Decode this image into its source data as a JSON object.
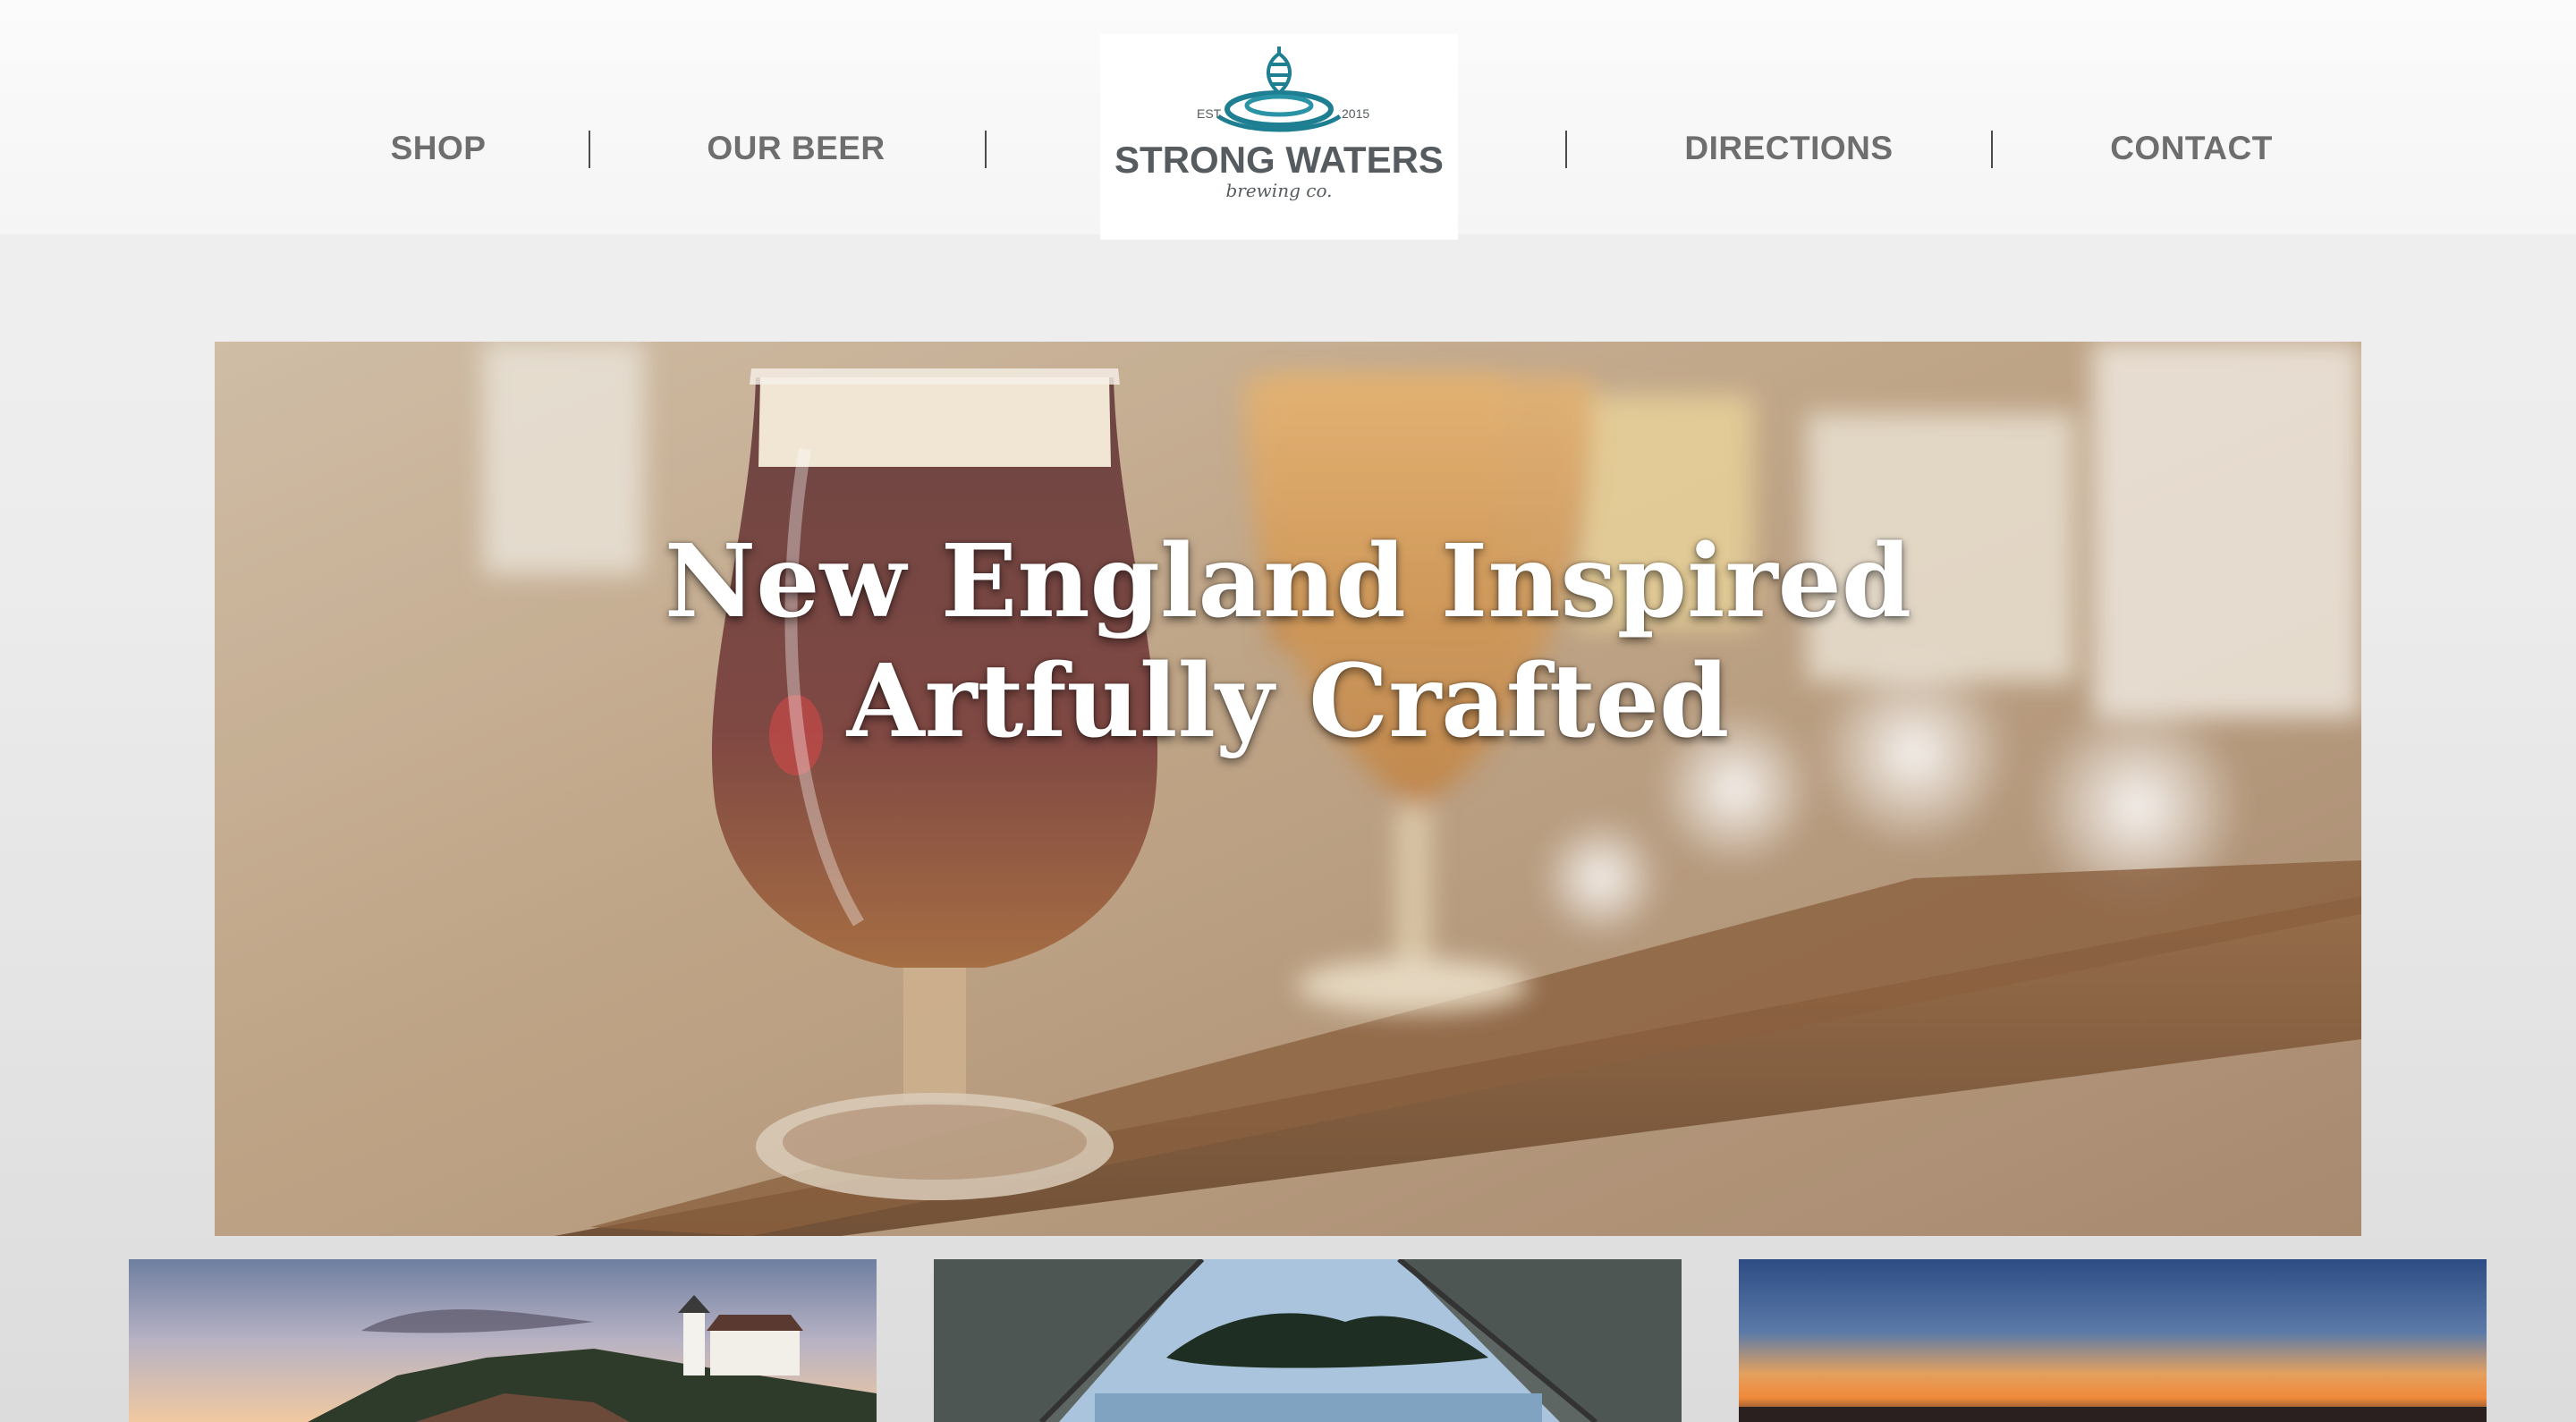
{
  "nav": {
    "shop": "SHOP",
    "our_beer": "OUR BEER",
    "directions": "DIRECTIONS",
    "contact": "CONTACT"
  },
  "logo": {
    "est_label": "EST.",
    "year": "2015",
    "name": "STRONG WATERS",
    "tagline": "brewing co."
  },
  "hero": {
    "line1": "New England Inspired",
    "line2": "Artfully Crafted"
  },
  "colors": {
    "nav_text": "#6e6e6e",
    "logo_teal": "#1f7f92",
    "logo_text": "#555b5e"
  },
  "icons": {
    "logo_mark": "hop-ripple-icon"
  },
  "thumbnails": [
    {
      "subject": "lighthouse"
    },
    {
      "subject": "tent-view"
    },
    {
      "subject": "sunset"
    }
  ]
}
